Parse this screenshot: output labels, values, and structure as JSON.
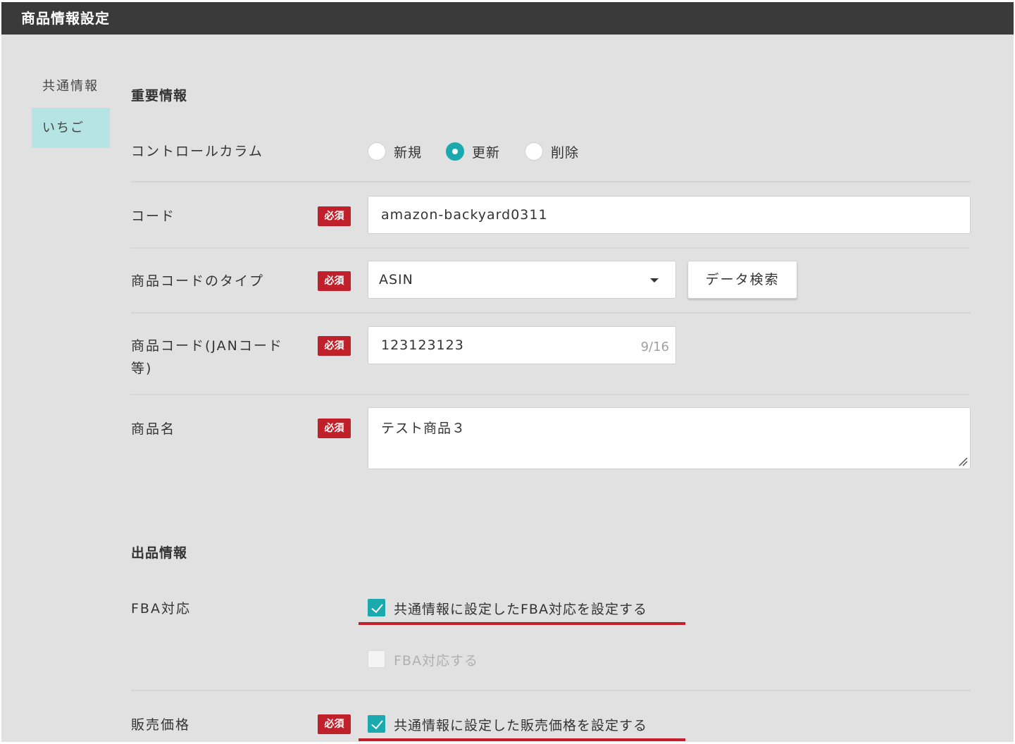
{
  "window": {
    "title": "商品情報設定"
  },
  "sidebar": {
    "items": [
      {
        "label": "共通情報",
        "active": false
      },
      {
        "label": "いちご",
        "active": true
      }
    ]
  },
  "sections": {
    "important": {
      "title": "重要情報",
      "control_column": {
        "label": "コントロールカラム",
        "options": [
          "新規",
          "更新",
          "削除"
        ],
        "selected": "更新"
      },
      "code": {
        "label": "コード",
        "required": "必須",
        "value": "amazon-backyard0311"
      },
      "code_type": {
        "label": "商品コードのタイプ",
        "required": "必須",
        "value": "ASIN",
        "search_button": "データ検索"
      },
      "product_code": {
        "label_line1": "商品コード(JANコード",
        "label_line2": "等)",
        "required": "必須",
        "value": "123123123",
        "counter": "9/16"
      },
      "product_name": {
        "label": "商品名",
        "required": "必須",
        "value": "テスト商品３"
      }
    },
    "listing": {
      "title": "出品情報",
      "fba": {
        "label": "FBA対応",
        "use_common": {
          "label": "共通情報に設定したFBA対応を設定する",
          "checked": true
        },
        "enable": {
          "label": "FBA対応する",
          "checked": false,
          "disabled": true
        }
      },
      "price": {
        "label": "販売価格",
        "required": "必須",
        "use_common": {
          "label": "共通情報に設定した販売価格を設定する",
          "checked": true
        }
      }
    }
  },
  "colors": {
    "accent": "#1aa9ae",
    "required": "#c0202a",
    "highlight_underline": "#c3202b",
    "sidebar_active": "#b6e4e4"
  }
}
